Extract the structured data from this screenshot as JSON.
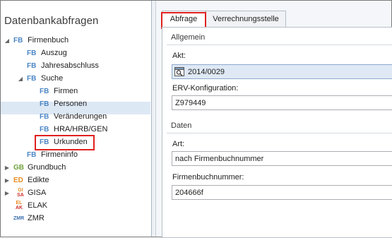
{
  "left_panel": {
    "title": "Datenbankabfragen",
    "tree": [
      {
        "icon": "FB",
        "label": "Firmenbuch"
      },
      {
        "icon": "FB",
        "label": "Auszug"
      },
      {
        "icon": "FB",
        "label": "Jahresabschluss"
      },
      {
        "icon": "FB",
        "label": "Suche"
      },
      {
        "icon": "FB",
        "label": "Firmen"
      },
      {
        "icon": "FB",
        "label": "Personen"
      },
      {
        "icon": "FB",
        "label": "Veränderungen"
      },
      {
        "icon": "FB",
        "label": "HRA/HRB/GEN"
      },
      {
        "icon": "FB",
        "label": "Urkunden"
      },
      {
        "icon": "FB",
        "label": "Firmeninfo"
      },
      {
        "icon": "GB",
        "label": "Grundbuch"
      },
      {
        "icon": "ED",
        "label": "Edikte"
      },
      {
        "icon_top": "GI",
        "icon_bottom": "SA",
        "label": "GISA"
      },
      {
        "icon_top": "EL",
        "icon_bottom": "AK",
        "label": "ELAK"
      },
      {
        "icon": "ZMR",
        "label": "ZMR"
      }
    ]
  },
  "tabs": [
    {
      "label": "Abfrage"
    },
    {
      "label": "Verrechnungsstelle"
    }
  ],
  "form": {
    "group_general": "Allgemein",
    "akt_label": "Akt:",
    "akt_value": "2014/0029",
    "erv_label": "ERV-Konfiguration:",
    "erv_value": "Z979449",
    "group_data": "Daten",
    "art_label": "Art:",
    "art_value": "nach Firmenbuchnummer",
    "fbn_label": "Firmenbuchnummer:",
    "fbn_value": "204666f"
  },
  "colors": {
    "fb": "#4a86c5",
    "gb": "#6fa23a",
    "ed": "#e58a1f",
    "gisa_top": "#e58a1f",
    "gisa_bottom": "#d0302a",
    "highlight_box": "#e02020",
    "selection": "#dde8f5"
  }
}
